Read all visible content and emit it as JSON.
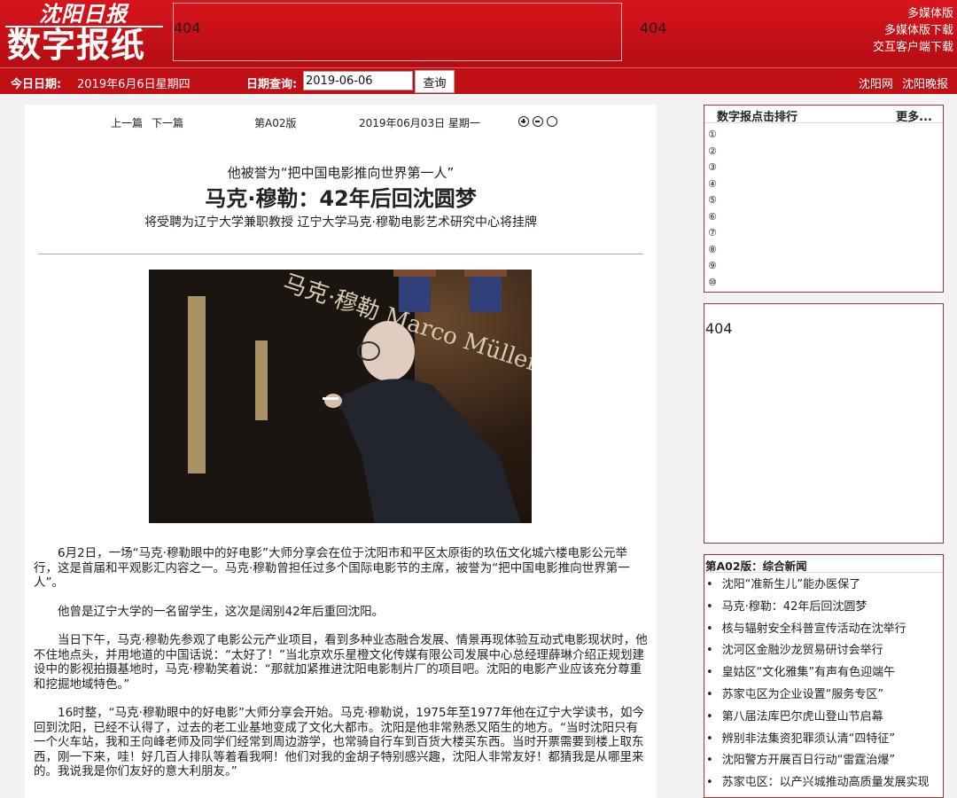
{
  "header": {
    "logo_top": "沈阳日报",
    "logo_main": "数字报纸",
    "ad_404_a": "404",
    "ad_404_b": "404",
    "links": [
      "多媒体版",
      "多媒体版下载",
      "交互客户端下载"
    ]
  },
  "datebar": {
    "today_label": "今日日期:",
    "today_value": "2019年6月6日星期四",
    "query_label": "日期查询:",
    "query_value": "2019-06-06",
    "query_button": "查询",
    "right_links": [
      "沈阳网",
      "沈阳晚报"
    ]
  },
  "article": {
    "nav": {
      "prev": "上一篇",
      "next": "下一篇",
      "edition": "第A02版",
      "date": "2019年06月03日 星期一"
    },
    "zoom_icons": [
      "zoom-in-icon",
      "zoom-out-icon",
      "zoom-reset-icon"
    ],
    "pre_title": "他被誉为“把中国电影推向世界第一人”",
    "title": "马克·穆勒：42年后回沈圆梦",
    "subtitle": "将受聘为辽宁大学兼职教授 辽宁大学马克·穆勒电影艺术研究中心将挂牌",
    "photo_text": "马克·穆勒 Marco Müller",
    "paragraphs": [
      "6月2日，一场“马克·穆勒眼中的好电影”大师分享会在位于沈阳市和平区太原街的玖伍文化城六楼电影公元举行，这是首届和平观影汇内容之一。马克·穆勒曾担任过多个国际电影节的主席，被誉为“把中国电影推向世界第一人”。",
      "他曾是辽宁大学的一名留学生，这次是阔别42年后重回沈阳。",
      "当日下午，马克·穆勒先参观了电影公元产业项目，看到多种业态融合发展、情景再现体验互动式电影现状时，他不住地点头，并用地道的中国话说：“太好了！”当北京欢乐星橙文化传媒有限公司发展中心总经理薛琳介绍正规划建设中的影视拍摄基地时，马克·穆勒笑着说：“那就加紧推进沈阳电影制片厂的项目吧。沈阳的电影产业应该充分尊重和挖掘地域特色。”",
      "16时整，“马克·穆勒眼中的好电影”大师分享会开始。马克·穆勒说，1975年至1977年他在辽宁大学读书，如今回到沈阳，已经不认得了，过去的老工业基地变成了文化大都市。沈阳是他非常熟悉又陌生的地方。“当时沈阳只有一个火车站，我和王向峰老师及同学们经常到周边游学，也常骑自行车到百货大楼买东西。当时开票需要到楼上取东西，刚一下来，哇！好几百人排队等着看我啊！他们对我的金胡子特别感兴趣，沈阳人非常友好！都猜我是从哪里来的。我说我是你们友好的意大利朋友。”"
    ]
  },
  "rank": {
    "title": "数字报点击排行",
    "more": "更多...",
    "items": [
      "①",
      "②",
      "③",
      "④",
      "⑤",
      "⑥",
      "⑦",
      "⑧",
      "⑨",
      "⑩"
    ]
  },
  "ad_side": "404",
  "news": {
    "title": "第A02版：综合新闻",
    "items": [
      "沈阳“准新生儿”能办医保了",
      "马克·穆勒：42年后回沈圆梦",
      "核与辐射安全科普宣传活动在沈举行",
      "沈河区金融沙龙贸易研讨会举行",
      "皇姑区“文化雅集”有声有色迎端午",
      "苏家屯区为企业设置“服务专区”",
      "第八届法库巴尔虎山登山节启幕",
      "辨别非法集资犯罪须认清“四特征”",
      "沈阳警方开展百日行动“雷霆治爆”",
      "苏家屯区：以产兴城推动高质量发展实现"
    ]
  }
}
